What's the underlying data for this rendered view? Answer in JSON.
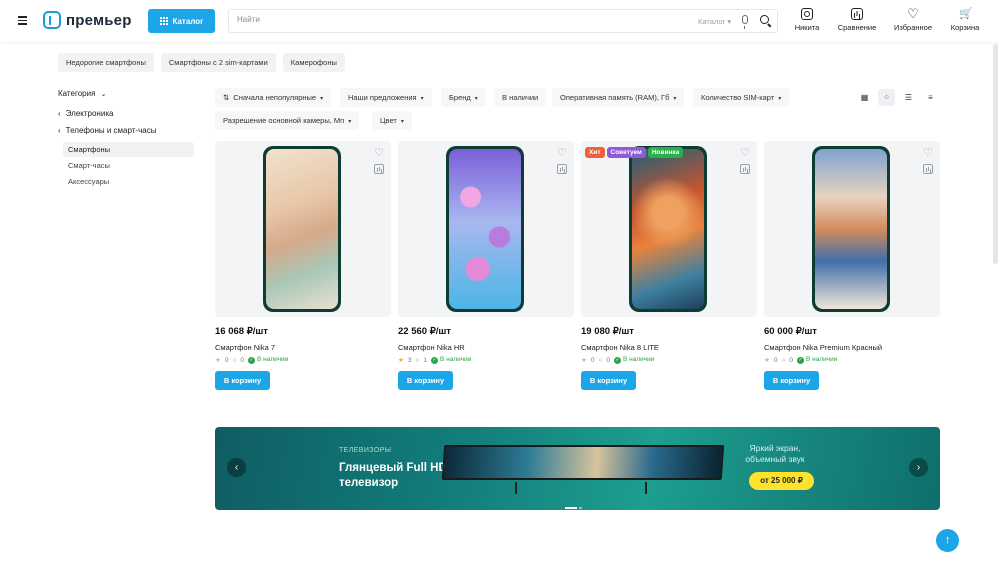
{
  "header": {
    "logo_text": "премьер",
    "catalog_label": "Каталог",
    "search_placeholder": "Найти",
    "search_scope": "Каталог ▾",
    "user_label": "Никита",
    "compare_label": "Сравнение",
    "favorites_label": "Избранное",
    "cart_label": "Корзина"
  },
  "tags": [
    "Недорогие смартфоны",
    "Смартфоны с 2 sim-картами",
    "Камерофоны"
  ],
  "sidebar": {
    "category_label": "Категория",
    "parent_1": "Электроника",
    "parent_2": "Телефоны и смарт-часы",
    "items": [
      {
        "label": "Смартфоны",
        "active": true
      },
      {
        "label": "Смарт-часы",
        "active": false
      },
      {
        "label": "Аксессуары",
        "active": false
      }
    ]
  },
  "filters": {
    "sort": "Сначала непопулярные",
    "offers": "Наши предложения",
    "brand": "Бренд",
    "in_stock": "В наличии",
    "ram": "Оперативная память (RAM), Гб",
    "sim_count": "Количество SIM-карт",
    "camera": "Разрешение основной камеры, Мп",
    "color": "Цвет"
  },
  "products": [
    {
      "price": "16 068 ₽/шт",
      "name": "Смартфон Nika 7",
      "rating": "0",
      "reviews": "0",
      "stock": "В наличии",
      "buy_label": "В корзину",
      "badges": []
    },
    {
      "price": "22 560 ₽/шт",
      "name": "Смартфон Nika HR",
      "rating": "3",
      "reviews": "1",
      "stock": "В наличии",
      "buy_label": "В корзину",
      "badges": []
    },
    {
      "price": "19 080 ₽/шт",
      "name": "Смартфон Nika 8 LITE",
      "rating": "0",
      "reviews": "0",
      "stock": "В наличии",
      "buy_label": "В корзину",
      "badges": [
        "Хит",
        "Советуем",
        "Новинка"
      ]
    },
    {
      "price": "60 000 ₽/шт",
      "name": "Смартфон Nika Premium Красный",
      "rating": "0",
      "reviews": "0",
      "stock": "В наличии",
      "buy_label": "В корзину",
      "badges": []
    }
  ],
  "banner": {
    "kicker": "ТЕЛЕВИЗОРЫ",
    "title": "Глянцевый Full HD телевизор",
    "side_text": "Яркий экран, объемный звук",
    "price": "от 25 000 ₽"
  },
  "colors": {
    "accent": "#1ca6e8",
    "badge_hit": "#f0603a",
    "badge_recommend": "#8f5bd6",
    "badge_new": "#27b04b",
    "in_stock": "#2aa347"
  }
}
